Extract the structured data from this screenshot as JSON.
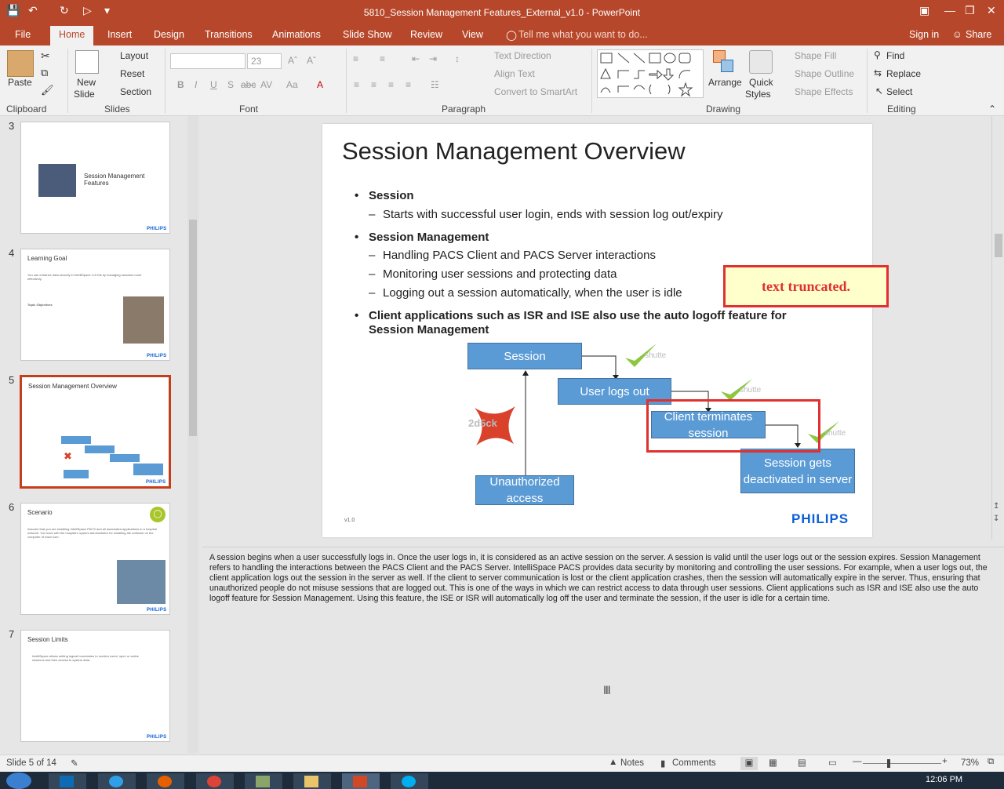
{
  "window": {
    "title": "5810_Session Management Features_External_v1.0 - PowerPoint"
  },
  "tabs": {
    "file": "File",
    "home": "Home",
    "insert": "Insert",
    "design": "Design",
    "transitions": "Transitions",
    "animations": "Animations",
    "slideshow": "Slide Show",
    "review": "Review",
    "view": "View",
    "tellme": "Tell me what you want to do...",
    "signin": "Sign in",
    "share": "Share"
  },
  "ribbon": {
    "clipboard": {
      "paste": "Paste",
      "label": "Clipboard"
    },
    "slides": {
      "new_slide_1": "New",
      "new_slide_2": "Slide",
      "layout": "Layout",
      "reset": "Reset",
      "section": "Section",
      "label": "Slides"
    },
    "font": {
      "size": "23",
      "label": "Font"
    },
    "paragraph": {
      "text_direction": "Text Direction",
      "align_text": "Align Text",
      "convert": "Convert to SmartArt",
      "label": "Paragraph"
    },
    "drawing": {
      "arrange": "Arrange",
      "quick_1": "Quick",
      "quick_2": "Styles",
      "shape_fill": "Shape Fill",
      "shape_outline": "Shape Outline",
      "shape_effects": "Shape Effects",
      "label": "Drawing"
    },
    "editing": {
      "find": "Find",
      "replace": "Replace",
      "select": "Select",
      "label": "Editing"
    }
  },
  "thumbnails": [
    {
      "num": "3",
      "title": "Session Management Features"
    },
    {
      "num": "4",
      "title": "Learning Goal",
      "body": "You can enhance data security in IntelliSpace 4.4 this by managing sessions more effectively.",
      "sub": "Topic Objectives"
    },
    {
      "num": "5",
      "title": "Session Management Overview"
    },
    {
      "num": "6",
      "title": "Scenario",
      "body": "Assume that you are installing IntelliSpace PACS and all associated applications in a hospital network. You work with the hospital's system administrator for installing the software on the computer of each user."
    },
    {
      "num": "7",
      "title": "Session Limits",
      "body": "IntelliSpace allows setting logical boundaries to monitor users' open or active sessions and their access to system data."
    }
  ],
  "thumb_brand": "PHILIPS",
  "slide": {
    "title": "Session Management Overview",
    "b1": "Session",
    "b1s1": "Starts with successful user login, ends with session log out/expiry",
    "b2": "Session Management",
    "b2s1": "Handling PACS Client and PACS Server interactions",
    "b2s2": "Monitoring user sessions and protecting data",
    "b2s3": "Logging out a session automatically, when the user is idle",
    "b3": "Client applications such as ISR and ISE also use the auto logoff feature for Session Management",
    "box_session": "Session",
    "box_logout": "User logs out",
    "box_client": "Client terminates session",
    "box_server": "Session gets deactivated in server",
    "box_unauth": "Unauthorized access",
    "watermark": "shutte",
    "watermark_x": "2d5ck",
    "version": "v1.0",
    "brand": "PHILIPS",
    "callout": "text truncated."
  },
  "notes": "A session begins when a user successfully logs in. Once the user logs in, it is considered as an active session on the server. A session is valid until the user logs out or the session expires. Session Management refers to handling the interactions between the PACS Client and the PACS Server. IntelliSpace PACS provides data security by monitoring and controlling the user sessions. For example, when a user logs out, the client application logs out the session in the server as well. If the client to server communication is lost or the client application crashes, then the session will automatically expire in the server. Thus, ensuring that unauthorized people do not misuse sessions that are logged out. This is one of the ways in which we can restrict access to data through user sessions. Client applications such as ISR and ISE also use the auto logoff feature for Session Management. Using this feature, the ISE or ISR will automatically log off the user and terminate the session, if the user is idle for a certain time.",
  "status": {
    "slide": "Slide 5 of 14",
    "notes": "Notes",
    "comments": "Comments",
    "zoom": "73%"
  },
  "taskbar": {
    "time": "12:06 PM"
  }
}
